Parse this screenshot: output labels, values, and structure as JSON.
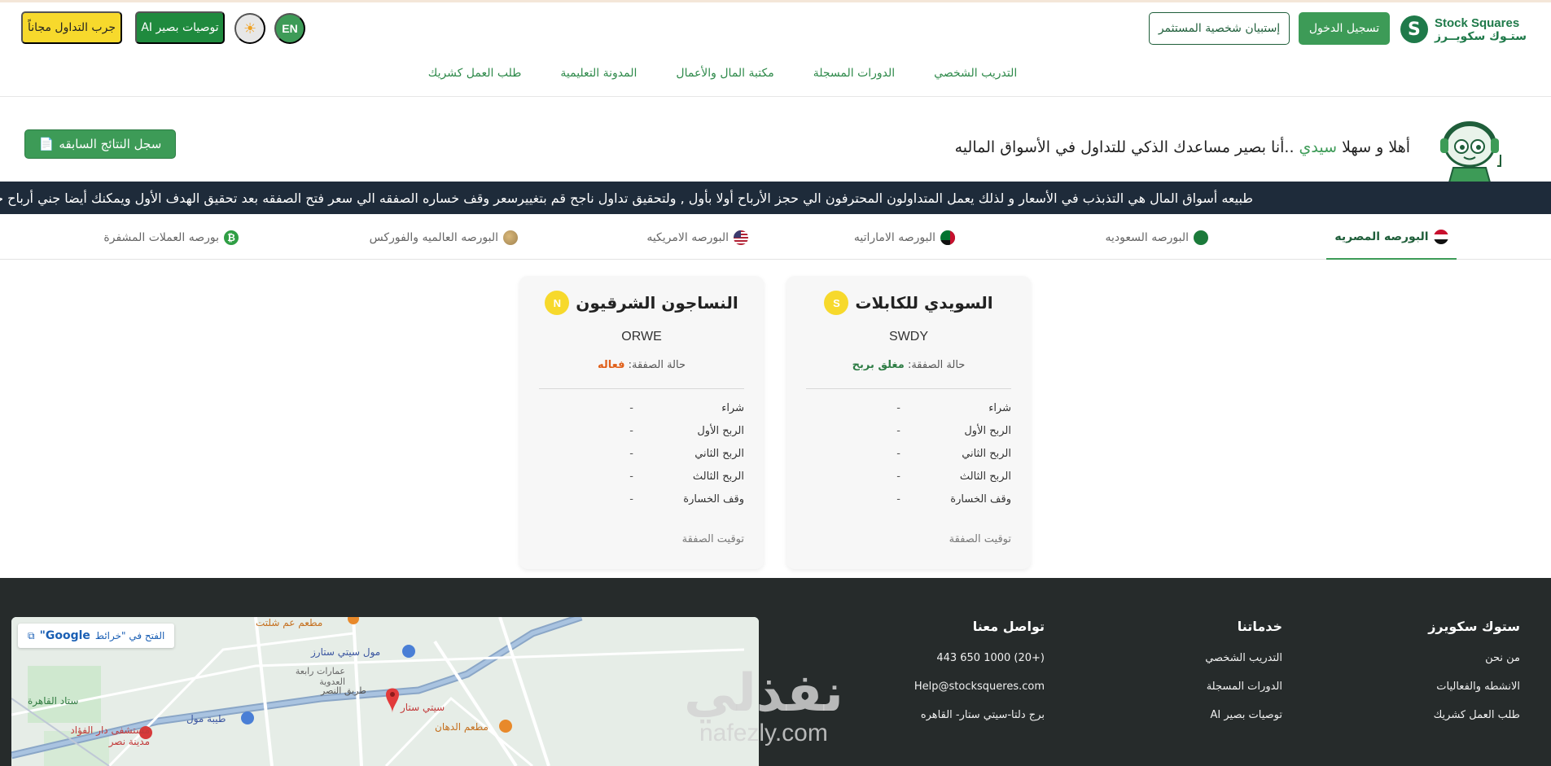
{
  "brand": {
    "logo_en": "Stock Squares",
    "logo_ar": "ستـوك سكويــرز",
    "logo_mark": "S"
  },
  "header": {
    "login_label": "تسجيل الدخول",
    "survey_label": "إستبيان شخصية المستثمر",
    "lang_label": "EN",
    "theme_icon": "☀",
    "ai_label": "توصيات بصير AI",
    "trial_label": "جرب التداول مجاناً"
  },
  "nav": {
    "items": [
      "التدريب الشخصي",
      "الدورات المسجلة",
      "مكتبة المال والأعمال",
      "المدونة التعليمية",
      "طلب العمل كشريك"
    ]
  },
  "welcome": {
    "prefix": "أهلا و سهلا",
    "name": "سيدي",
    "suffix": "..أنا بصير مساعدك الذكي للتداول في الأسواق الماليه",
    "history_label": "سجل النتائج السابقه",
    "history_icon": "📄"
  },
  "ticker": {
    "text": "طبيعه أسواق المال هي التذبذب في الأسعار و لذلك يعمل المتداولون المحترفون الي حجز الأرباح أولا بأول , ولتحقيق تداول ناجح قم بتغييرسعر وقف خساره الصفقه الي سعر فتح الصفقه بعد تحقيق الهدف الأول ويمكنك أيضا جني أرباح جزء"
  },
  "tabs": [
    {
      "label": "البورصه المصريه",
      "flag": "egypt-flag",
      "active": true
    },
    {
      "label": "البورصه السعوديه",
      "flag": "saudi-flag",
      "active": false
    },
    {
      "label": "البورصه الاماراتيه",
      "flag": "uae-flag",
      "active": false
    },
    {
      "label": "البورصه الامريكيه",
      "flag": "usa-flag",
      "active": false
    },
    {
      "label": "البورصه العالميه والفوركس",
      "flag": "globe-icon",
      "active": false
    },
    {
      "label": "بورصه العملات المشفرة",
      "flag": "bitcoin-icon",
      "active": false
    }
  ],
  "cards": [
    {
      "badge": "S",
      "title": "السويدي للكابلات",
      "symbol": "SWDY",
      "status_label": "حالة الصفقة:",
      "status_value": "مغلق بربح",
      "rows": [
        {
          "label": "شراء",
          "value": "-"
        },
        {
          "label": "الربح الأول",
          "value": "-"
        },
        {
          "label": "الربح الثاني",
          "value": "-"
        },
        {
          "label": "الربح الثالث",
          "value": "-"
        },
        {
          "label": "وقف الخسارة",
          "value": "-"
        }
      ],
      "time_label": "توقيت الصفقة"
    },
    {
      "badge": "N",
      "title": "النساجون الشرقيون",
      "symbol": "ORWE",
      "status_label": "حالة الصفقة:",
      "status_value": "فعاله",
      "rows": [
        {
          "label": "شراء",
          "value": "-"
        },
        {
          "label": "الربح الأول",
          "value": "-"
        },
        {
          "label": "الربح الثاني",
          "value": "-"
        },
        {
          "label": "الربح الثالث",
          "value": "-"
        },
        {
          "label": "وقف الخسارة",
          "value": "-"
        }
      ],
      "time_label": "توقيت الصفقة"
    }
  ],
  "footer": {
    "col1": {
      "title": "ستوك سكويرز",
      "items": [
        "من نحن",
        "الانشطه والفعاليات",
        "طلب العمل كشريك"
      ]
    },
    "col2": {
      "title": "خدماتنا",
      "items": [
        "التدريب الشخصي",
        "الدورات المسجلة",
        "توصيات بصير AI"
      ]
    },
    "col3": {
      "title": "تواصل معنا",
      "items": [
        "443 650 1000 (20+)",
        "Help@stocksqueres.com",
        "برج دلتا-سيتي ستار- القاهره"
      ]
    },
    "map_open_label": "الفتح في \"خرائط",
    "map_open_brand": "Google\"",
    "map_labels": [
      "مول سيتي ستارز",
      "طيبة مول",
      "سيتي ستار",
      "مطعم الدهان",
      "مستشفى دار الفؤاد مدينة نصر",
      "عمارات رابعة العدوية",
      "ستاد القاهرة",
      "طريق النصر",
      "مطعم عم شلتت"
    ]
  },
  "watermark": {
    "ar": "نفذلي",
    "en": "nafezly.com"
  },
  "colors": {
    "primary": "#3d9b57",
    "dark": "#1f5e3a",
    "yellow": "#f7d92c",
    "ticker_bg": "#1e2b3a",
    "footer_bg": "#262b2b",
    "active_status": "#e0601a"
  }
}
